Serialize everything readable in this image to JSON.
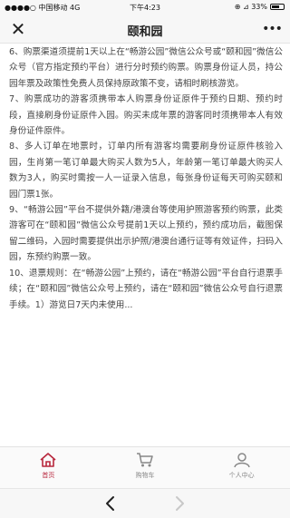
{
  "status_bar": {
    "carrier": "●●●●○ 中国移动  4G",
    "time": "下午4:23",
    "right": "⊕ ⊿ 33%"
  },
  "nav": {
    "title": "颐和园",
    "close_icon": "close-icon",
    "more_icon": "more-icon"
  },
  "content": {
    "paragraphs": [
      "6、购票渠道须提前1天以上在“畅游公园”微信公众号或“颐和园”微信公众号（官方指定预约平台）进行分时预约购票。购票身份证人员，持公园年票及政策性免费人员保持原政策不变，请相时刷核游览。",
      "7、购票成功的游客须携带本人购票身份证原件于预约日期、预约时段，直接刷身份证原件入园。购买未成年票的游客同时须携带本人有效身份证件原件。",
      "8、多人订单在地票时，订单内所有游客均需要刷身份证原件核验入园，生肖第一笔订单最大购买人数为5人，年龄第一笔订单最大购买人数为3人，购买时需按一人一证录入信息，每张身份证每天可购买颐和园门票1张。",
      "9、“畅游公园”平台不提供外籍/港澳台等使用护照游客预约购票，此类游客可在“颐和园”微信公众号提前1天以上预约，预约成功后，截图保留二维码，入园时需要提供出示护照/港澳台通行证等有效证件，扫码入园，东预约购票一致。",
      "10、退票规则：在“畅游公园”上预约，请在“畅游公园”平台自行退票手续；在“颐和园”微信公众号上预约，请在“颐和园”微信公众号自行退票手续。1）游览日7天内未使用..."
    ]
  },
  "tabs": [
    {
      "label": "首页",
      "icon": "home-icon",
      "active": true
    },
    {
      "label": "购物车",
      "icon": "cart-icon",
      "active": false
    },
    {
      "label": "个人中心",
      "icon": "user-icon",
      "active": false
    }
  ],
  "browser": {
    "back_icon": "back-arrow-icon",
    "forward_icon": "forward-arrow-icon"
  },
  "colors": {
    "accent": "#b8273d",
    "inactive": "#888888"
  }
}
